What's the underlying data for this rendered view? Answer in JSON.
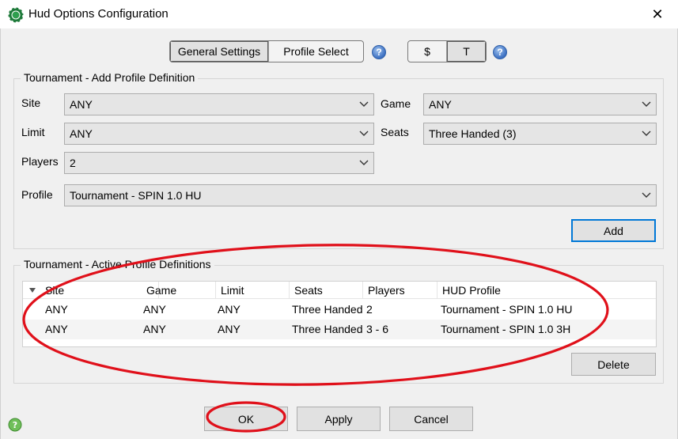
{
  "window": {
    "title": "Hud Options Configuration",
    "icon": "poker-chip-icon",
    "close_glyph": "✕"
  },
  "mode_tabs": [
    {
      "label": "General Settings",
      "active": true
    },
    {
      "label": "Profile Select",
      "active": false
    }
  ],
  "currency_tabs": [
    {
      "label": "$",
      "active": false
    },
    {
      "label": "T",
      "active": true
    }
  ],
  "help_glyph": "?",
  "add_group": {
    "title": "Tournament - Add Profile Definition",
    "site": {
      "label": "Site",
      "value": "ANY"
    },
    "game": {
      "label": "Game",
      "value": "ANY"
    },
    "limit": {
      "label": "Limit",
      "value": "ANY"
    },
    "seats": {
      "label": "Seats",
      "value": "Three Handed (3)"
    },
    "players": {
      "label": "Players",
      "value": "2"
    },
    "profile": {
      "label": "Profile",
      "value": "Tournament - SPIN 1.0 HU"
    },
    "add_button": "Add"
  },
  "active_group": {
    "title": "Tournament - Active Profile Definitions",
    "columns": [
      "Site",
      "Game",
      "Limit",
      "Seats",
      "Players",
      "HUD Profile"
    ],
    "rows": [
      [
        "ANY",
        "ANY",
        "ANY",
        "Three Handed",
        "2",
        "Tournament - SPIN 1.0 HU"
      ],
      [
        "ANY",
        "ANY",
        "ANY",
        "Three Handed",
        "3 - 6",
        "Tournament - SPIN 1.0 3H"
      ]
    ],
    "delete_button": "Delete"
  },
  "footer": {
    "ok": "OK",
    "apply": "Apply",
    "cancel": "Cancel"
  },
  "colors": {
    "annotation": "#e0101a",
    "accent": "#0078d7",
    "help": "#3c70c2"
  }
}
